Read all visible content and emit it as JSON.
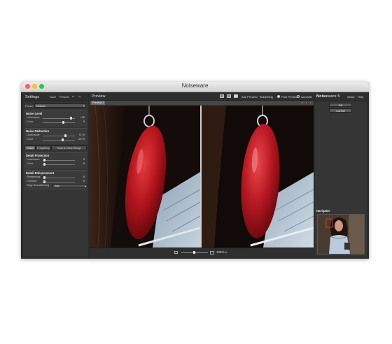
{
  "window": {
    "title": "Noiseware"
  },
  "settings": {
    "title": "Settings",
    "save_label": "Save",
    "presets_label": "Presets",
    "undo_label": "↶",
    "redo_label": "↷",
    "preset_label": "Preset",
    "preset_value": "Default",
    "noise_level": {
      "title": "Noise Level",
      "rows": [
        {
          "label": "Luminance",
          "value": "+20",
          "knob": 0.88
        },
        {
          "label": "Color",
          "value": "0",
          "knob": 0.65
        }
      ]
    },
    "noise_reduction": {
      "title": "Noise Reduction",
      "rows": [
        {
          "label": "Luminance",
          "value": "71 %",
          "knob": 0.71
        },
        {
          "label": "Color",
          "value": "62 %",
          "knob": 0.62
        }
      ]
    },
    "tabs": [
      "Detail",
      "Frequency",
      "Tonal & Color Range"
    ],
    "detail_protection": {
      "title": "Detail Protection",
      "rows": [
        {
          "label": "Luminance",
          "value": "5",
          "knob": 0.05
        },
        {
          "label": "Color",
          "value": "5",
          "knob": 0.05
        }
      ]
    },
    "detail_enhancement": {
      "title": "Detail Enhancement",
      "rows": [
        {
          "label": "Sharpening",
          "value": "5",
          "knob": 0.05
        },
        {
          "label": "Contrast",
          "value": "5",
          "knob": 0.05
        }
      ],
      "edge_label": "Edge Smoothening",
      "edge_value": "Auto"
    }
  },
  "preview": {
    "title": "Preview",
    "add_preview_label": "Add Preview",
    "bracketing_label": "Bracketing",
    "fast_preview_label": "Fast Preview",
    "accurate_label": "Accurate",
    "tab_label": "Preview 1",
    "zoom_value": "100%"
  },
  "right": {
    "brand_main": "Noise",
    "brand_rest": "ware 5",
    "about_label": "About",
    "help_label": "Help",
    "ok_label": "OK",
    "cancel_label": "Cancel",
    "navigator_label": "Navigator"
  },
  "colors": {
    "accent_red": "#b3141c",
    "panel_bg": "#353535",
    "preview_bg": "#111111"
  }
}
